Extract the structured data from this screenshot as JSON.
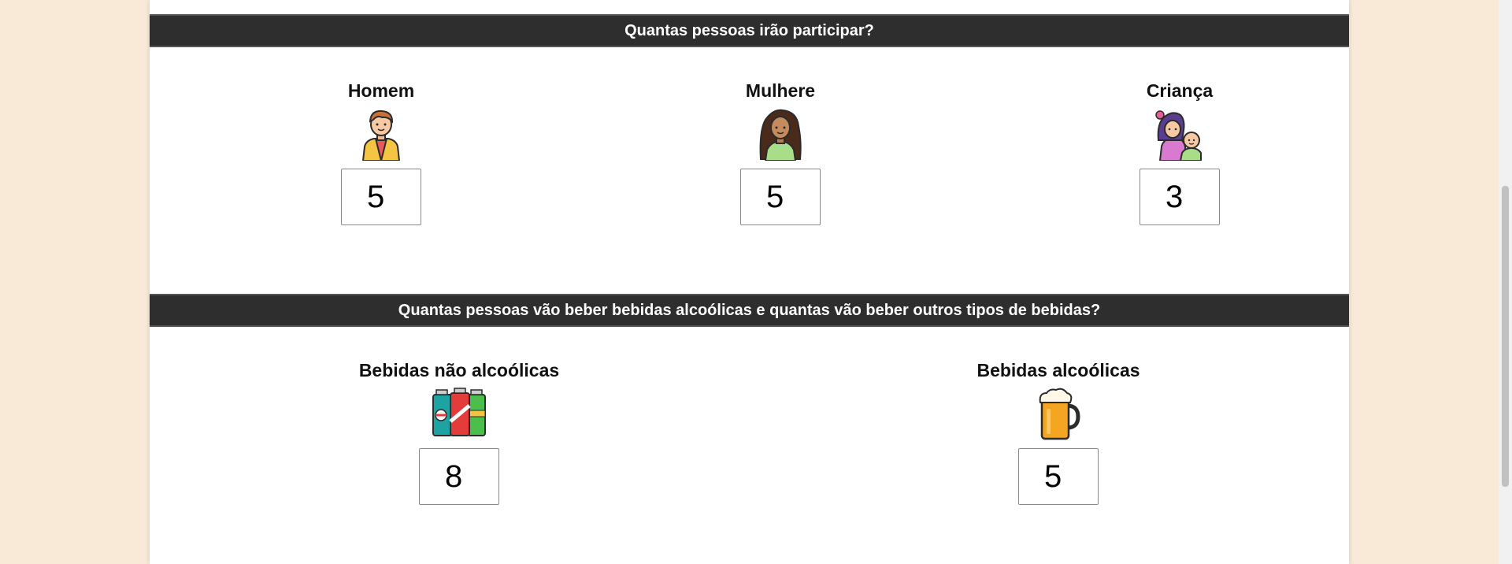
{
  "sections": [
    {
      "title": "Quantas pessoas irão participar?",
      "items": [
        {
          "label": "Homem",
          "icon": "man-icon",
          "value": "5"
        },
        {
          "label": "Mulhere",
          "icon": "woman-icon",
          "value": "5"
        },
        {
          "label": "Criança",
          "icon": "children-icon",
          "value": "3"
        }
      ]
    },
    {
      "title": "Quantas pessoas vão beber bebidas alcoólicas e quantas vão beber outros tipos de bebidas?",
      "items": [
        {
          "label": "Bebidas não alcoólicas",
          "icon": "soda-cans-icon",
          "value": "8"
        },
        {
          "label": "Bebidas alcoólicas",
          "icon": "beer-mug-icon",
          "value": "5"
        }
      ]
    }
  ],
  "colors": {
    "background": "#f8ead6",
    "header": "#2e2e2e",
    "panel": "#ffffff"
  }
}
